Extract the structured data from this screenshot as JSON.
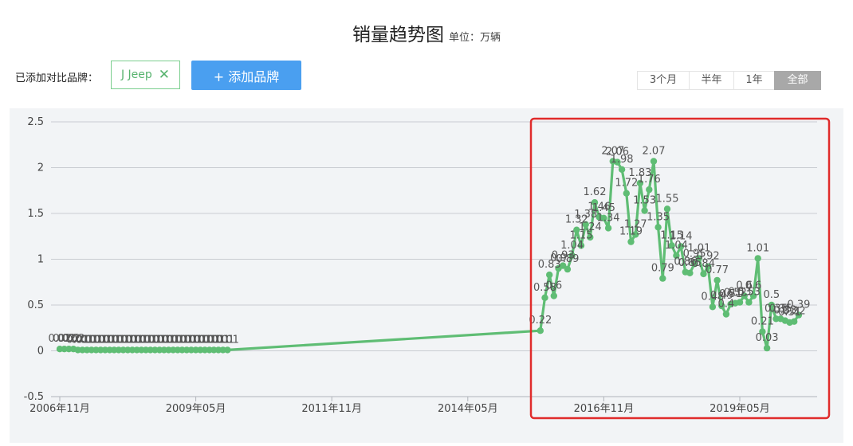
{
  "header": {
    "title": "销量趋势图",
    "unit": "单位：万辆"
  },
  "compare": {
    "label": "已添加对比品牌：",
    "brands": [
      {
        "name": "J Jeep",
        "remove_icon": "close-icon"
      }
    ],
    "add_button": "+ 添加品牌"
  },
  "range_tabs": [
    {
      "label": "3个月",
      "active": false
    },
    {
      "label": "半年",
      "active": false
    },
    {
      "label": "1年",
      "active": false
    },
    {
      "label": "全部",
      "active": true
    }
  ],
  "colors": {
    "series": "#5fbd74",
    "highlight_box": "#e02b2b",
    "add_button": "#4a9ff0"
  },
  "chart_data": {
    "type": "line",
    "title": "销量趋势图",
    "unit": "单位：万辆",
    "xlabel": "",
    "ylabel": "",
    "ylim": [
      -0.5,
      2.5
    ],
    "yticks": [
      "-0.5",
      "0",
      "0.5",
      "1",
      "1.5",
      "2",
      "2.5"
    ],
    "xticks": [
      "2006年11月",
      "2009年05月",
      "2011年11月",
      "2014年05月",
      "2016年11月",
      "2019年05月"
    ],
    "grid": true,
    "series": [
      {
        "name": "J Jeep",
        "points": [
          {
            "x": "2006-11",
            "y": 0.02
          },
          {
            "x": "2006-12",
            "y": 0.02
          },
          {
            "x": "2007-01",
            "y": 0.02
          },
          {
            "x": "2007-02",
            "y": 0.02
          },
          {
            "x": "2007-03",
            "y": 0.01
          },
          {
            "x": "2007-04",
            "y": 0.01
          },
          {
            "x": "2007-05",
            "y": 0.01
          },
          {
            "x": "2007-06",
            "y": 0.01
          },
          {
            "x": "2007-07",
            "y": 0.01
          },
          {
            "x": "2007-08",
            "y": 0.01
          },
          {
            "x": "2007-09",
            "y": 0.01
          },
          {
            "x": "2007-10",
            "y": 0.01
          },
          {
            "x": "2007-11",
            "y": 0.01
          },
          {
            "x": "2007-12",
            "y": 0.01
          },
          {
            "x": "2008-01",
            "y": 0.01
          },
          {
            "x": "2008-02",
            "y": 0.01
          },
          {
            "x": "2008-03",
            "y": 0.01
          },
          {
            "x": "2008-04",
            "y": 0.01
          },
          {
            "x": "2008-05",
            "y": 0.01
          },
          {
            "x": "2008-06",
            "y": 0.01
          },
          {
            "x": "2008-07",
            "y": 0.01
          },
          {
            "x": "2008-08",
            "y": 0.01
          },
          {
            "x": "2008-09",
            "y": 0.01
          },
          {
            "x": "2008-10",
            "y": 0.01
          },
          {
            "x": "2008-11",
            "y": 0.01
          },
          {
            "x": "2008-12",
            "y": 0.01
          },
          {
            "x": "2009-01",
            "y": 0.01
          },
          {
            "x": "2009-02",
            "y": 0.01
          },
          {
            "x": "2009-03",
            "y": 0.01
          },
          {
            "x": "2009-04",
            "y": 0.01
          },
          {
            "x": "2009-05",
            "y": 0.01
          },
          {
            "x": "2009-06",
            "y": 0.01
          },
          {
            "x": "2009-07",
            "y": 0.01
          },
          {
            "x": "2009-08",
            "y": 0.01
          },
          {
            "x": "2009-09",
            "y": 0.01
          },
          {
            "x": "2009-10",
            "y": 0.01
          },
          {
            "x": "2009-11",
            "y": 0.01
          },
          {
            "x": "2009-12",
            "y": 0.01
          },
          {
            "x": "2015-09",
            "y": 0.22
          },
          {
            "x": "2015-10",
            "y": 0.58
          },
          {
            "x": "2015-11",
            "y": 0.83
          },
          {
            "x": "2015-12",
            "y": 0.6
          },
          {
            "x": "2016-01",
            "y": 0.9
          },
          {
            "x": "2016-02",
            "y": 0.93
          },
          {
            "x": "2016-03",
            "y": 0.89
          },
          {
            "x": "2016-04",
            "y": 1.04
          },
          {
            "x": "2016-05",
            "y": 1.32
          },
          {
            "x": "2016-06",
            "y": 1.15
          },
          {
            "x": "2016-07",
            "y": 1.38
          },
          {
            "x": "2016-08",
            "y": 1.24
          },
          {
            "x": "2016-09",
            "y": 1.62
          },
          {
            "x": "2016-10",
            "y": 1.46
          },
          {
            "x": "2016-11",
            "y": 1.45
          },
          {
            "x": "2016-12",
            "y": 1.34
          },
          {
            "x": "2017-01",
            "y": 2.07
          },
          {
            "x": "2017-02",
            "y": 2.06
          },
          {
            "x": "2017-03",
            "y": 1.98
          },
          {
            "x": "2017-04",
            "y": 1.72
          },
          {
            "x": "2017-05",
            "y": 1.19
          },
          {
            "x": "2017-06",
            "y": 1.27
          },
          {
            "x": "2017-07",
            "y": 1.83
          },
          {
            "x": "2017-08",
            "y": 1.53
          },
          {
            "x": "2017-09",
            "y": 1.76
          },
          {
            "x": "2017-10",
            "y": 2.07
          },
          {
            "x": "2017-11",
            "y": 1.35
          },
          {
            "x": "2017-12",
            "y": 0.79
          },
          {
            "x": "2018-01",
            "y": 1.55
          },
          {
            "x": "2018-02",
            "y": 1.15
          },
          {
            "x": "2018-03",
            "y": 1.04
          },
          {
            "x": "2018-04",
            "y": 1.14
          },
          {
            "x": "2018-05",
            "y": 0.86
          },
          {
            "x": "2018-06",
            "y": 0.85
          },
          {
            "x": "2018-07",
            "y": 0.95
          },
          {
            "x": "2018-08",
            "y": 1.01
          },
          {
            "x": "2018-09",
            "y": 0.84
          },
          {
            "x": "2018-10",
            "y": 0.92
          },
          {
            "x": "2018-11",
            "y": 0.48
          },
          {
            "x": "2018-12",
            "y": 0.77
          },
          {
            "x": "2019-01",
            "y": 0.49
          },
          {
            "x": "2019-02",
            "y": 0.4
          },
          {
            "x": "2019-03",
            "y": 0.51
          },
          {
            "x": "2019-04",
            "y": 0.52
          },
          {
            "x": "2019-05",
            "y": 0.53
          },
          {
            "x": "2019-06",
            "y": 0.6
          },
          {
            "x": "2019-07",
            "y": 0.53
          },
          {
            "x": "2019-08",
            "y": 0.6
          },
          {
            "x": "2019-09",
            "y": 1.01
          },
          {
            "x": "2019-10",
            "y": 0.21
          },
          {
            "x": "2019-11",
            "y": 0.03
          },
          {
            "x": "2019-12",
            "y": 0.5
          },
          {
            "x": "2020-01",
            "y": 0.35
          },
          {
            "x": "2020-02",
            "y": 0.35
          },
          {
            "x": "2020-03",
            "y": 0.33
          },
          {
            "x": "2020-04",
            "y": 0.31
          },
          {
            "x": "2020-05",
            "y": 0.32
          },
          {
            "x": "2020-06",
            "y": 0.39
          }
        ]
      }
    ]
  }
}
